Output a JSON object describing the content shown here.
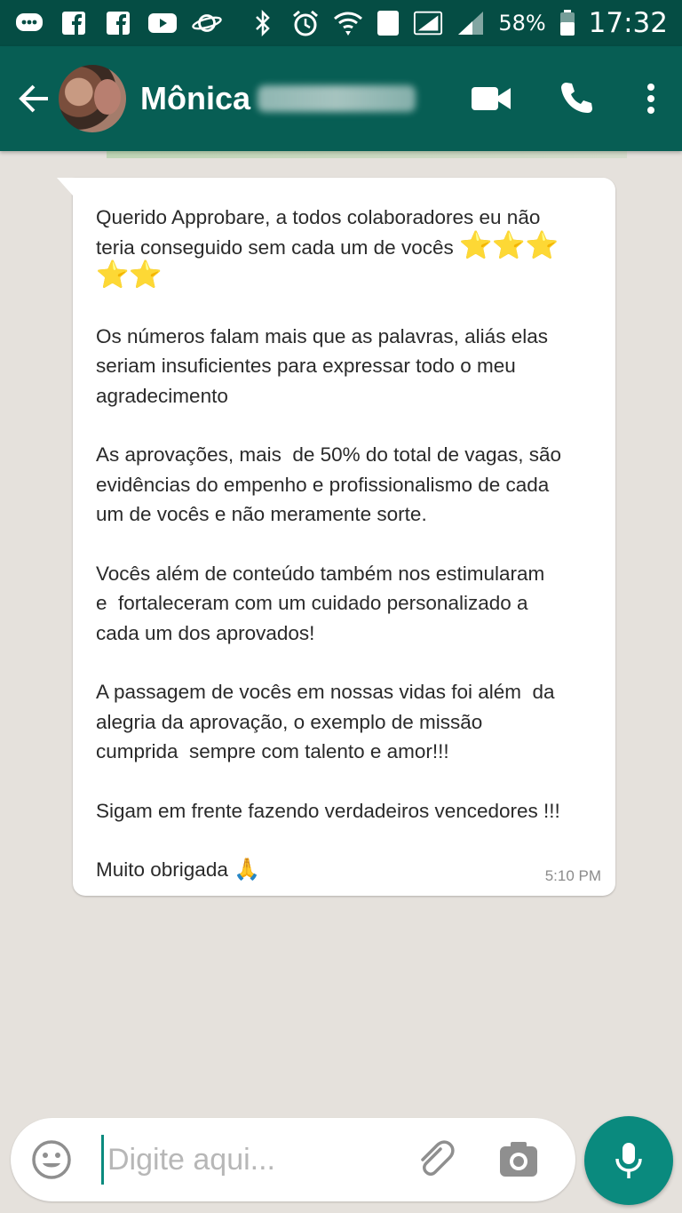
{
  "status_bar": {
    "battery_percent": "58%",
    "time": "17:32",
    "sim_slot": "1",
    "icons": [
      "message-icon",
      "facebook-icon",
      "facebook-icon",
      "youtube-icon",
      "planet-icon",
      "bluetooth-icon",
      "alarm-icon",
      "wifi-icon",
      "sim-icon",
      "signal-icon",
      "signal-icon",
      "battery-icon"
    ]
  },
  "header": {
    "contact_first_name": "Mônica",
    "icons": [
      "back-arrow-icon",
      "video-call-icon",
      "phone-icon",
      "more-vert-icon"
    ]
  },
  "message": {
    "line1": "Querido Approbare, a todos colaboradores eu não",
    "line2": "teria conseguido sem cada um de vocês",
    "stars": "⭐⭐⭐",
    "stars2": "⭐⭐",
    "para2_l1": "Os números falam mais que as palavras, aliás elas",
    "para2_l2": "seriam insuficientes para expressar todo o meu",
    "para2_l3": "agradecimento",
    "para3_l1": "As aprovações, mais  de 50% do total de vagas, são",
    "para3_l2": "evidências do empenho e profissionalismo de cada",
    "para3_l3": "um de vocês e não meramente sorte.",
    "para4_l1": "Vocês além de conteúdo também nos estimularam",
    "para4_l2": "e  fortaleceram com um cuidado personalizado a",
    "para4_l3": "cada um dos aprovados!",
    "para5_l1": "A passagem de vocês em nossas vidas foi além  da",
    "para5_l2": "alegria da aprovação, o exemplo de missão",
    "para5_l3": "cumprida  sempre com talento e amor!!!",
    "para6": "Sigam em frente fazendo verdadeiros vencedores !!!",
    "para7": "Muito obrigada",
    "pray_emoji": "🙏",
    "time": "5:10 PM"
  },
  "input": {
    "placeholder": "Digite aqui...",
    "value": "",
    "icons": [
      "emoji-icon",
      "attach-icon",
      "camera-icon",
      "mic-icon"
    ]
  },
  "colors": {
    "status_bar": "#054d44",
    "header": "#075e54",
    "chat_background": "#e5e1dc",
    "accent": "#0a8a7e"
  }
}
